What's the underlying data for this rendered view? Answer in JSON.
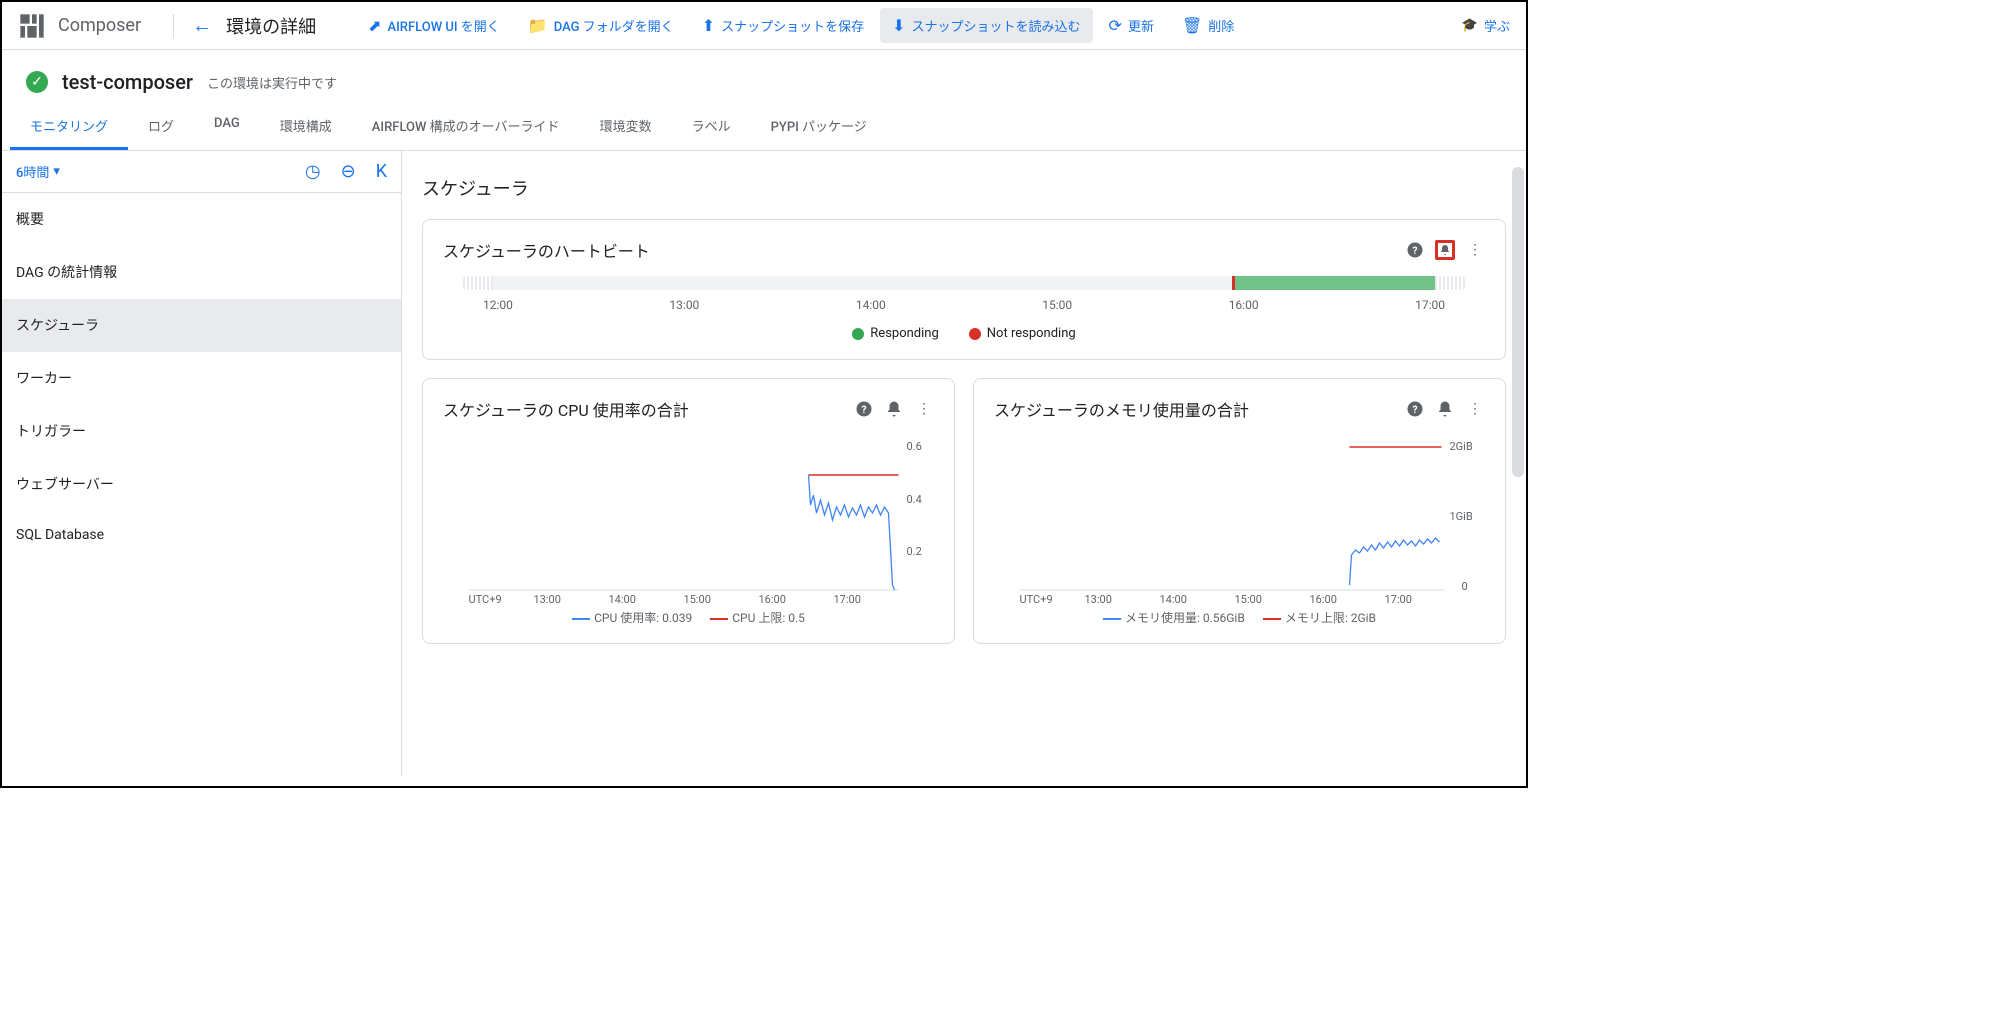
{
  "header": {
    "product": "Composer",
    "page_title": "環境の詳細",
    "actions": {
      "airflow_ui": "AIRFLOW UI を開く",
      "dag_folder": "DAG フォルダを開く",
      "save_snapshot": "スナップショットを保存",
      "load_snapshot": "スナップショットを読み込む",
      "refresh": "更新",
      "delete": "削除",
      "learn": "学ぶ"
    }
  },
  "env": {
    "name": "test-composer",
    "status": "この環境は実行中です"
  },
  "tabs": [
    "モニタリング",
    "ログ",
    "DAG",
    "環境構成",
    "AIRFLOW 構成のオーバーライド",
    "環境変数",
    "ラベル",
    "PYPI パッケージ"
  ],
  "time_range": "6時間",
  "sidebar": [
    "概要",
    "DAG の統計情報",
    "スケジューラ",
    "ワーカー",
    "トリガラー",
    "ウェブサーバー",
    "SQL Database"
  ],
  "section": "スケジューラ",
  "heartbeat": {
    "title": "スケジューラのハートビート",
    "xticks": [
      "12:00",
      "13:00",
      "14:00",
      "15:00",
      "16:00",
      "17:00"
    ],
    "legend": {
      "responding": "Responding",
      "not_responding": "Not responding"
    }
  },
  "cpu_card": {
    "title": "スケジューラの CPU 使用率の合計",
    "tz": "UTC+9",
    "xticks": [
      "13:00",
      "14:00",
      "15:00",
      "16:00",
      "17:00"
    ],
    "yticks": [
      "0.6",
      "0.4",
      "0.2"
    ],
    "legend_usage": "CPU 使用率: 0.039",
    "legend_limit": "CPU 上限: 0.5"
  },
  "mem_card": {
    "title": "スケジューラのメモリ使用量の合計",
    "tz": "UTC+9",
    "xticks": [
      "13:00",
      "14:00",
      "15:00",
      "16:00",
      "17:00"
    ],
    "yticks": [
      "2GiB",
      "1GiB",
      "0"
    ],
    "legend_usage": "メモリ使用量: 0.56GiB",
    "legend_limit": "メモリ上限: 2GiB"
  },
  "chart_data": [
    {
      "type": "bar",
      "title": "スケジューラのハートビート",
      "categories": [
        "12:00",
        "13:00",
        "14:00",
        "15:00",
        "16:00",
        "17:00"
      ],
      "series": [
        {
          "name": "Responding",
          "color": "#34a853",
          "range": [
            "16:25",
            "17:25"
          ]
        },
        {
          "name": "Not responding",
          "color": "#d93025",
          "range": [
            "16:24",
            "16:25"
          ]
        }
      ]
    },
    {
      "type": "line",
      "title": "スケジューラの CPU 使用率の合計",
      "x": [
        "13:00",
        "14:00",
        "15:00",
        "16:00",
        "17:00"
      ],
      "ylim": [
        0,
        0.6
      ],
      "series": [
        {
          "name": "CPU 使用率",
          "color": "#4285f4",
          "values_sample": [
            {
              "x": "16:25",
              "y": 0.5
            },
            {
              "x": "16:30",
              "y": 0.3
            },
            {
              "x": "17:00",
              "y": 0.3
            },
            {
              "x": "17:25",
              "y": 0.04
            }
          ],
          "note": "fluctuating 0.25–0.38 between 16:25–17:20, drop to 0.04 at end"
        },
        {
          "name": "CPU 上限",
          "color": "#d93025",
          "values": [
            {
              "x": "16:25",
              "y": 0.5
            },
            {
              "x": "17:25",
              "y": 0.5
            }
          ]
        }
      ]
    },
    {
      "type": "line",
      "title": "スケジューラのメモリ使用量の合計",
      "x": [
        "13:00",
        "14:00",
        "15:00",
        "16:00",
        "17:00"
      ],
      "ylim": [
        0,
        2.2
      ],
      "ylabel": "GiB",
      "series": [
        {
          "name": "メモリ使用量",
          "color": "#4285f4",
          "values_sample": [
            {
              "x": "16:25",
              "y": 0.3
            },
            {
              "x": "16:30",
              "y": 0.55
            },
            {
              "x": "17:25",
              "y": 0.56
            }
          ],
          "note": "approx 0.5–0.6 GiB after 16:30"
        },
        {
          "name": "メモリ上限",
          "color": "#d93025",
          "values": [
            {
              "x": "16:25",
              "y": 2.0
            },
            {
              "x": "17:25",
              "y": 2.0
            }
          ]
        }
      ]
    }
  ]
}
